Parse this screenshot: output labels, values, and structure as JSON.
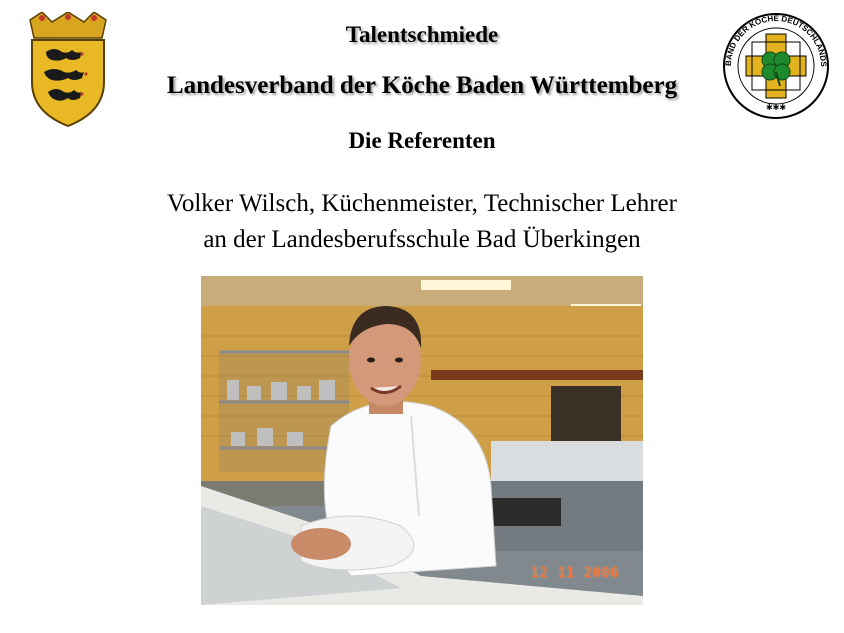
{
  "header": {
    "title_line1": "Talentschmiede",
    "title_line2": "Landesverband der Köche Baden Württemberg",
    "section_title": "Die Referenten"
  },
  "speaker": {
    "line1": "Volker Wilsch, Küchenmeister, Technischer Lehrer",
    "line2": "an der Landesberufsschule Bad Überkingen"
  },
  "logos": {
    "left": "baden-wuerttemberg-coat-of-arms",
    "right": "verband-der-koeche-deutschlands-emblem",
    "right_text": "VERBAND DER KÖCHE DEUTSCHLANDS e.V."
  },
  "photo": {
    "date_stamp": "12 11 2006"
  },
  "colors": {
    "text": "#000000",
    "logo_gold": "#e3b21f",
    "logo_green": "#1e8a2e",
    "date_stamp": "#ff6b2b"
  }
}
